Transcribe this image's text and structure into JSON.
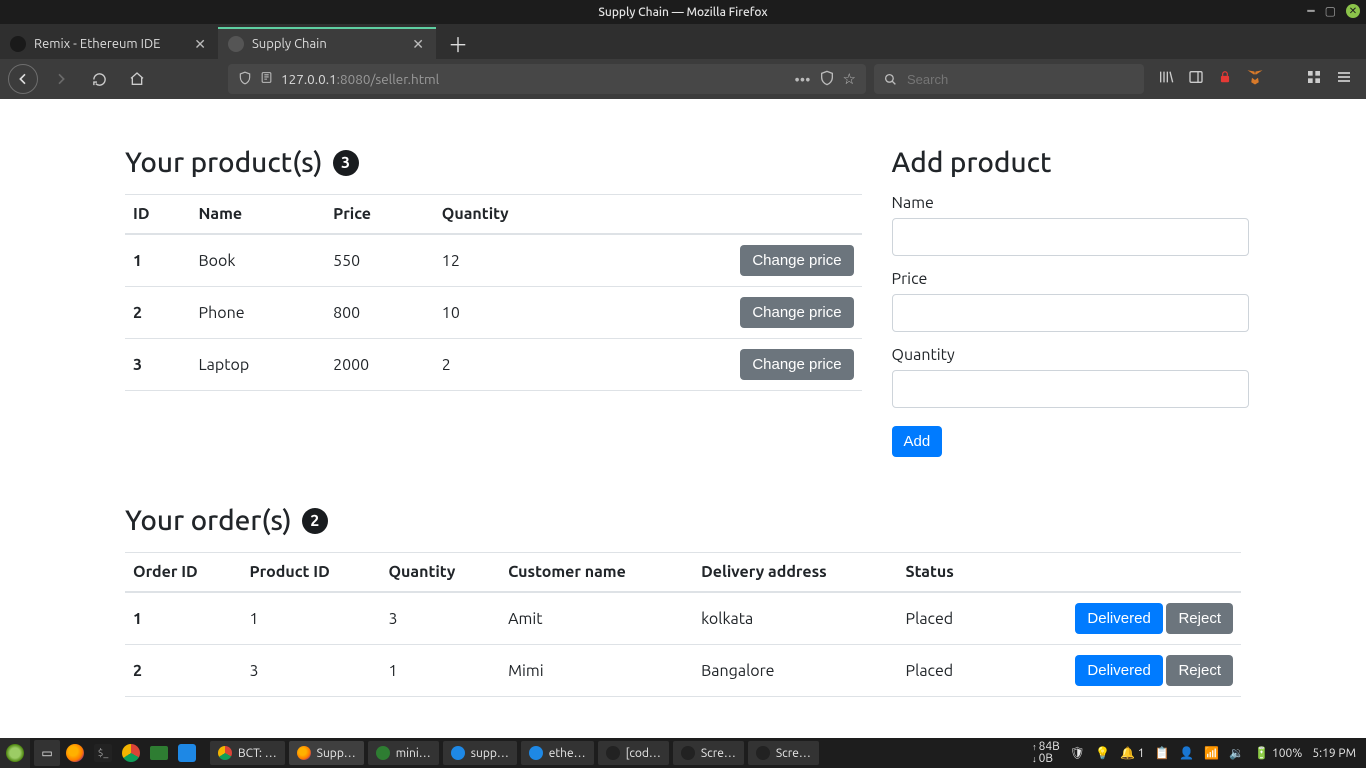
{
  "window": {
    "title": "Supply Chain — Mozilla Firefox"
  },
  "tabs": [
    {
      "label": "Remix - Ethereum IDE",
      "active": false
    },
    {
      "label": "Supply Chain",
      "active": true
    }
  ],
  "url": {
    "host": "127.0.0.1",
    "port": ":8080",
    "path": "/seller.html"
  },
  "search": {
    "placeholder": "Search"
  },
  "products": {
    "title": "Your product(s)",
    "count": "3",
    "headers": [
      "ID",
      "Name",
      "Price",
      "Quantity",
      ""
    ],
    "action_label": "Change price",
    "rows": [
      {
        "id": "1",
        "name": "Book",
        "price": "550",
        "qty": "12"
      },
      {
        "id": "2",
        "name": "Phone",
        "price": "800",
        "qty": "10"
      },
      {
        "id": "3",
        "name": "Laptop",
        "price": "2000",
        "qty": "2"
      }
    ]
  },
  "add_product": {
    "title": "Add product",
    "name_label": "Name",
    "price_label": "Price",
    "qty_label": "Quantity",
    "submit": "Add"
  },
  "orders": {
    "title": "Your order(s)",
    "count": "2",
    "headers": [
      "Order ID",
      "Product ID",
      "Quantity",
      "Customer name",
      "Delivery address",
      "Status",
      ""
    ],
    "delivered_label": "Delivered",
    "reject_label": "Reject",
    "rows": [
      {
        "oid": "1",
        "pid": "1",
        "qty": "3",
        "cust": "Amit",
        "addr": "kolkata",
        "status": "Placed"
      },
      {
        "oid": "2",
        "pid": "3",
        "qty": "1",
        "cust": "Mimi",
        "addr": "Bangalore",
        "status": "Placed"
      }
    ]
  },
  "task_items": [
    {
      "label": "BCT: …"
    },
    {
      "label": "Supp…",
      "active": true
    },
    {
      "label": "mini…"
    },
    {
      "label": "supp…"
    },
    {
      "label": "ethe…"
    },
    {
      "label": "[cod…"
    },
    {
      "label": "Scre…"
    },
    {
      "label": "Scre…"
    }
  ],
  "tray": {
    "net_up": "84B",
    "net_dn": "0B",
    "notif": "1",
    "battery": "100%",
    "clock": "5:19 PM"
  }
}
